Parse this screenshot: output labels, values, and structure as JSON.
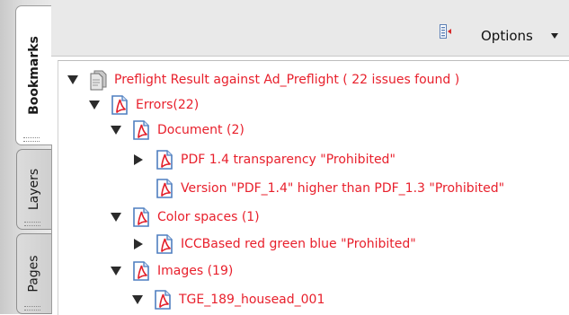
{
  "tabs": [
    {
      "label": "Bookmarks",
      "active": true
    },
    {
      "label": "Layers",
      "active": false
    },
    {
      "label": "Pages",
      "active": false
    }
  ],
  "toolbar": {
    "options_label": "Options",
    "options_icon": "options-menu-icon"
  },
  "tree": {
    "root": {
      "label": "Preflight Result against Ad_Preflight ( 22 issues found )",
      "icon": "document-stack-icon",
      "expanded": true
    },
    "errors": {
      "label": "Errors(22)",
      "icon": "pdf-icon",
      "expanded": true
    },
    "document": {
      "label": "Document (2)",
      "icon": "pdf-icon",
      "expanded": true
    },
    "transparency": {
      "label": "PDF 1.4 transparency \"Prohibited\"",
      "icon": "pdf-icon",
      "expanded": false
    },
    "version": {
      "label": "Version \"PDF_1.4\" higher than PDF_1.3 \"Prohibited\"",
      "icon": "pdf-icon"
    },
    "color_spaces": {
      "label": "Color spaces (1)",
      "icon": "pdf-icon",
      "expanded": true
    },
    "iccbased": {
      "label": "ICCBased red green blue \"Prohibited\"",
      "icon": "pdf-icon",
      "expanded": false
    },
    "images": {
      "label": "Images (19)",
      "icon": "pdf-icon",
      "expanded": true
    },
    "tge": {
      "label": "TGE_189_housead_001",
      "icon": "pdf-icon",
      "expanded": true
    }
  },
  "colors": {
    "item_text": "#e8202c",
    "tab_strip": "#d8d8d8",
    "toolbar_bg": "#e9e9e9"
  }
}
